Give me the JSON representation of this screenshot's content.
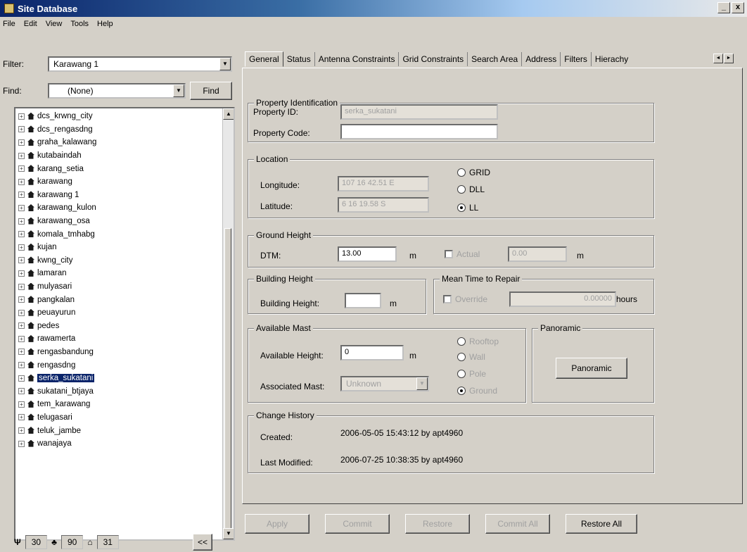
{
  "window": {
    "title": "Site Database",
    "min": "_",
    "close": "x"
  },
  "menu": [
    "File",
    "Edit",
    "View",
    "Tools",
    "Help"
  ],
  "filter": {
    "label": "Filter:",
    "value": "Karawang 1"
  },
  "find": {
    "label": "Find:",
    "value": "(None)",
    "button": "Find"
  },
  "tree": [
    "dcs_krwng_city",
    "dcs_rengasdng",
    "graha_kalawang",
    "kutabaindah",
    "karang_setia",
    "karawang",
    "karawang 1",
    "karawang_kulon",
    "karawang_osa",
    "komala_tmhabg",
    "kujan",
    "kwng_city",
    "lamaran",
    "mulyasari",
    "pangkalan",
    "peuayurun",
    "pedes",
    "rawamerta",
    "rengasbandung",
    "rengasdng",
    "serka_sukatani",
    "sukatani_btjaya",
    "tem_karawang",
    "telugasari",
    "teluk_jambe",
    "wanajaya"
  ],
  "tree_selected_index": 20,
  "status": {
    "c1": "30",
    "c2": "90",
    "c3": "31",
    "collapse": "<<"
  },
  "tabs": [
    "General",
    "Status",
    "Antenna Constraints",
    "Grid Constraints",
    "Search Area",
    "Address",
    "Filters",
    "Hierachy"
  ],
  "tab_scroll": {
    "left": "◄",
    "right": "►"
  },
  "prop": {
    "legend": "Property Identification",
    "id_label": "Property ID:",
    "id_value": "serka_sukatani",
    "code_label": "Property Code:",
    "code_value": ""
  },
  "location": {
    "legend": "Location",
    "lon_label": "Longitude:",
    "lon_value": "107 16 42.51 E",
    "lat_label": "Latitude:",
    "lat_value": "6 16 19.58 S",
    "r_grid": "GRID",
    "r_dll": "DLL",
    "r_ll": "LL"
  },
  "ground": {
    "legend": "Ground Height",
    "dtm_label": "DTM:",
    "dtm_value": "13.00",
    "unit": "m",
    "actual_label": "Actual",
    "actual_value": "0.00",
    "unit2": "m"
  },
  "building": {
    "legend": "Building Height",
    "label": "Building Height:",
    "value": "",
    "unit": "m"
  },
  "mean_time": {
    "legend": "Mean Time to Repair",
    "check_label": "Override",
    "value": "0.00000",
    "unit": "hours"
  },
  "mast": {
    "legend": "Available Mast",
    "height_label": "Available Height:",
    "height_value": "0",
    "unit": "m",
    "assoc_label": "Associated Mast:",
    "assoc_value": "Unknown",
    "r_rooftop": "Rooftop",
    "r_wall": "Wall",
    "r_pole": "Pole",
    "r_ground": "Ground"
  },
  "panoramic": {
    "legend": "Panoramic",
    "button": "Panoramic"
  },
  "history": {
    "legend": "Change History",
    "created_label": "Created:",
    "created_value": "2006-05-05 15:43:12 by apt4960",
    "modified_label": "Last Modified:",
    "modified_value": "2006-07-25 10:38:35 by apt4960"
  },
  "bottom": {
    "b1": "Apply",
    "b2": "Commit",
    "b3": "Restore",
    "b4": "Commit All",
    "b5": "Restore All"
  }
}
